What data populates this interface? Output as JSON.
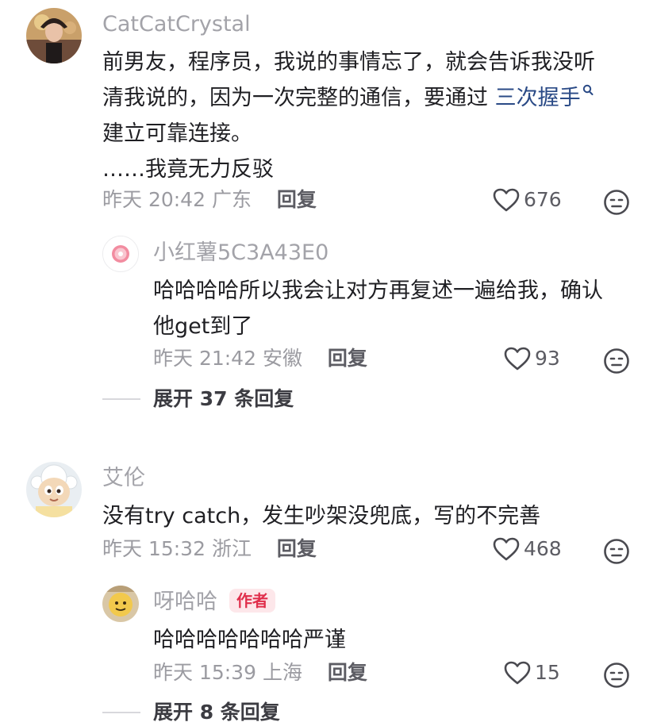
{
  "comments": [
    {
      "username": "CatCatCrystal",
      "content_lines": [
        "前男友，程序员，我说的事情忘了，就会告诉我没听",
        "清我说的，因为一次完整的通信，要通过 ",
        "建立可靠连接。",
        "……我竟无力反驳"
      ],
      "link_text": "三次握手",
      "time": "昨天 20:42",
      "location": "广东",
      "reply_label": "回复",
      "likes": "676",
      "replies": [
        {
          "username": "小红薯5C3A43E0",
          "content_lines": [
            "哈哈哈哈所以我会让对方再复述一遍给我，确认",
            "他get到了"
          ],
          "time": "昨天 21:42",
          "location": "安徽",
          "reply_label": "回复",
          "likes": "93"
        }
      ],
      "expand_label": "展开 37 条回复"
    },
    {
      "username": "艾伦",
      "content_lines": [
        "没有try catch，发生吵架没兜底，写的不完善"
      ],
      "time": "昨天 15:32",
      "location": "浙江",
      "reply_label": "回复",
      "likes": "468",
      "replies": [
        {
          "username": "呀哈哈",
          "badge": "作者",
          "content_lines": [
            "哈哈哈哈哈哈哈严谨"
          ],
          "time": "昨天 15:39",
          "location": "上海",
          "reply_label": "回复",
          "likes": "15"
        }
      ],
      "expand_label": "展开 8 条回复"
    }
  ],
  "icons": {
    "like": "heart-outline-icon",
    "dislike": "unhappy-face-icon",
    "search_link": "search-icon"
  },
  "colors": {
    "username": "#a3a3a9",
    "text": "#1f1f23",
    "link": "#2a4a86",
    "badge_bg": "#fde7ea",
    "badge_text": "#e02e4b"
  }
}
